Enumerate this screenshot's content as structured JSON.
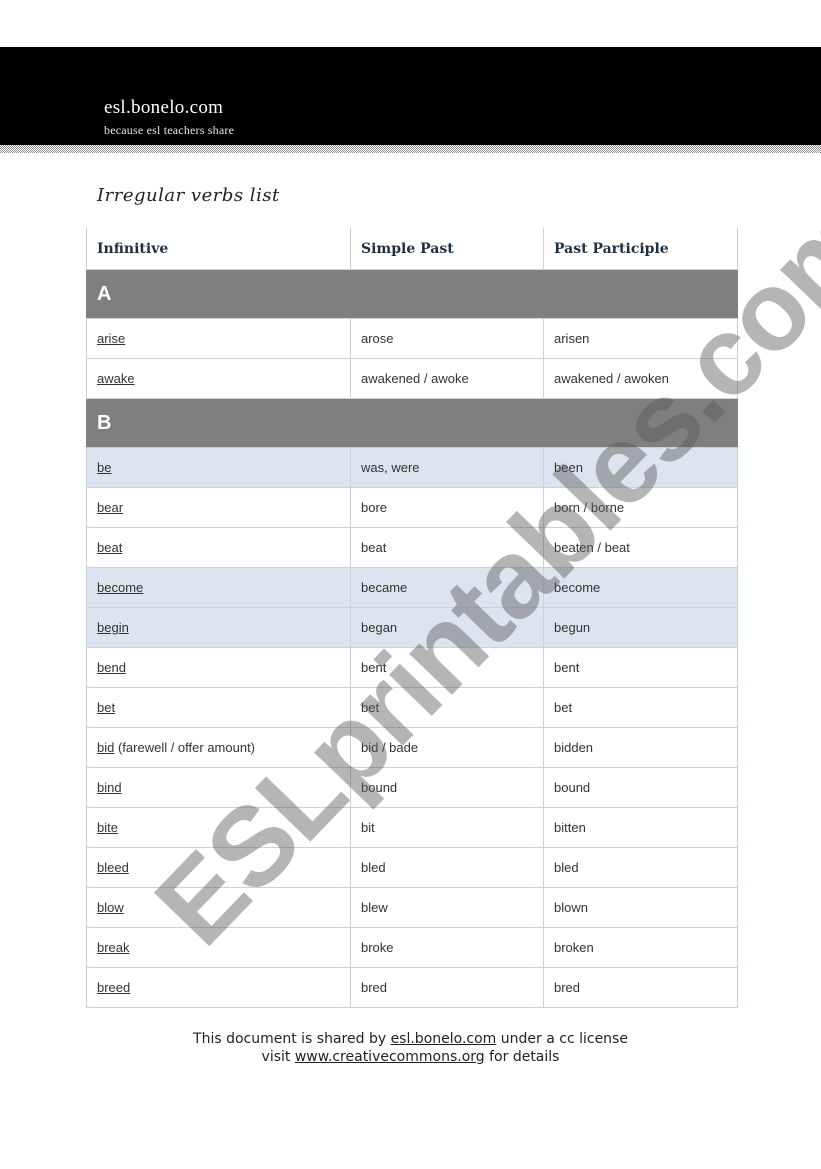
{
  "header": {
    "site_name": "esl.bonelo.com",
    "tagline": "because esl teachers share"
  },
  "document": {
    "title": "Irregular verbs list"
  },
  "table": {
    "columns": [
      "Infinitive",
      "Simple Past",
      "Past Participle"
    ],
    "sections": [
      {
        "letter": "A",
        "rows": [
          {
            "infinitive": "arise",
            "note": "",
            "simple_past": "arose",
            "past_participle": "arisen",
            "highlighted": false
          },
          {
            "infinitive": "awake",
            "note": "",
            "simple_past": "awakened / awoke",
            "past_participle": "awakened / awoken",
            "highlighted": false
          }
        ]
      },
      {
        "letter": "B",
        "rows": [
          {
            "infinitive": "be",
            "note": "",
            "simple_past": "was, were",
            "past_participle": "been",
            "highlighted": true
          },
          {
            "infinitive": "bear",
            "note": "",
            "simple_past": "bore",
            "past_participle": "born / borne",
            "highlighted": false
          },
          {
            "infinitive": "beat",
            "note": "",
            "simple_past": "beat",
            "past_participle": "beaten / beat",
            "highlighted": false
          },
          {
            "infinitive": "become",
            "note": "",
            "simple_past": "became",
            "past_participle": "become",
            "highlighted": true
          },
          {
            "infinitive": "begin",
            "note": "",
            "simple_past": "began",
            "past_participle": "begun",
            "highlighted": true
          },
          {
            "infinitive": "bend",
            "note": "",
            "simple_past": "bent",
            "past_participle": "bent",
            "highlighted": false
          },
          {
            "infinitive": "bet",
            "note": "",
            "simple_past": "bet",
            "past_participle": "bet",
            "highlighted": false
          },
          {
            "infinitive": "bid",
            "note": " (farewell / offer amount)",
            "simple_past": "bid / bade",
            "past_participle": "bidden",
            "highlighted": false
          },
          {
            "infinitive": "bind",
            "note": "",
            "simple_past": "bound",
            "past_participle": "bound",
            "highlighted": false
          },
          {
            "infinitive": "bite",
            "note": "",
            "simple_past": "bit",
            "past_participle": "bitten",
            "highlighted": false
          },
          {
            "infinitive": "bleed",
            "note": "",
            "simple_past": "bled",
            "past_participle": "bled",
            "highlighted": false
          },
          {
            "infinitive": "blow",
            "note": "",
            "simple_past": "blew",
            "past_participle": "blown",
            "highlighted": false
          },
          {
            "infinitive": "break",
            "note": "",
            "simple_past": "broke",
            "past_participle": "broken",
            "highlighted": false
          },
          {
            "infinitive": "breed",
            "note": "",
            "simple_past": "bred",
            "past_participle": "bred",
            "highlighted": false
          }
        ]
      }
    ]
  },
  "footer": {
    "line1_before": "This document is shared by ",
    "line1_link": "esl.bonelo.com",
    "line1_after": " under a cc license",
    "line2_before": "visit ",
    "line2_link": "www.creativecommons.org",
    "line2_after": " for details"
  },
  "watermark": {
    "text": "ESLprintables.com"
  },
  "colors": {
    "header_bg": "#000000",
    "section_bg": "#7f7f7f",
    "highlight_row_bg": "#dce4ef",
    "grid_line": "#c9d1dc",
    "column_header_text": "#1e2f44"
  }
}
